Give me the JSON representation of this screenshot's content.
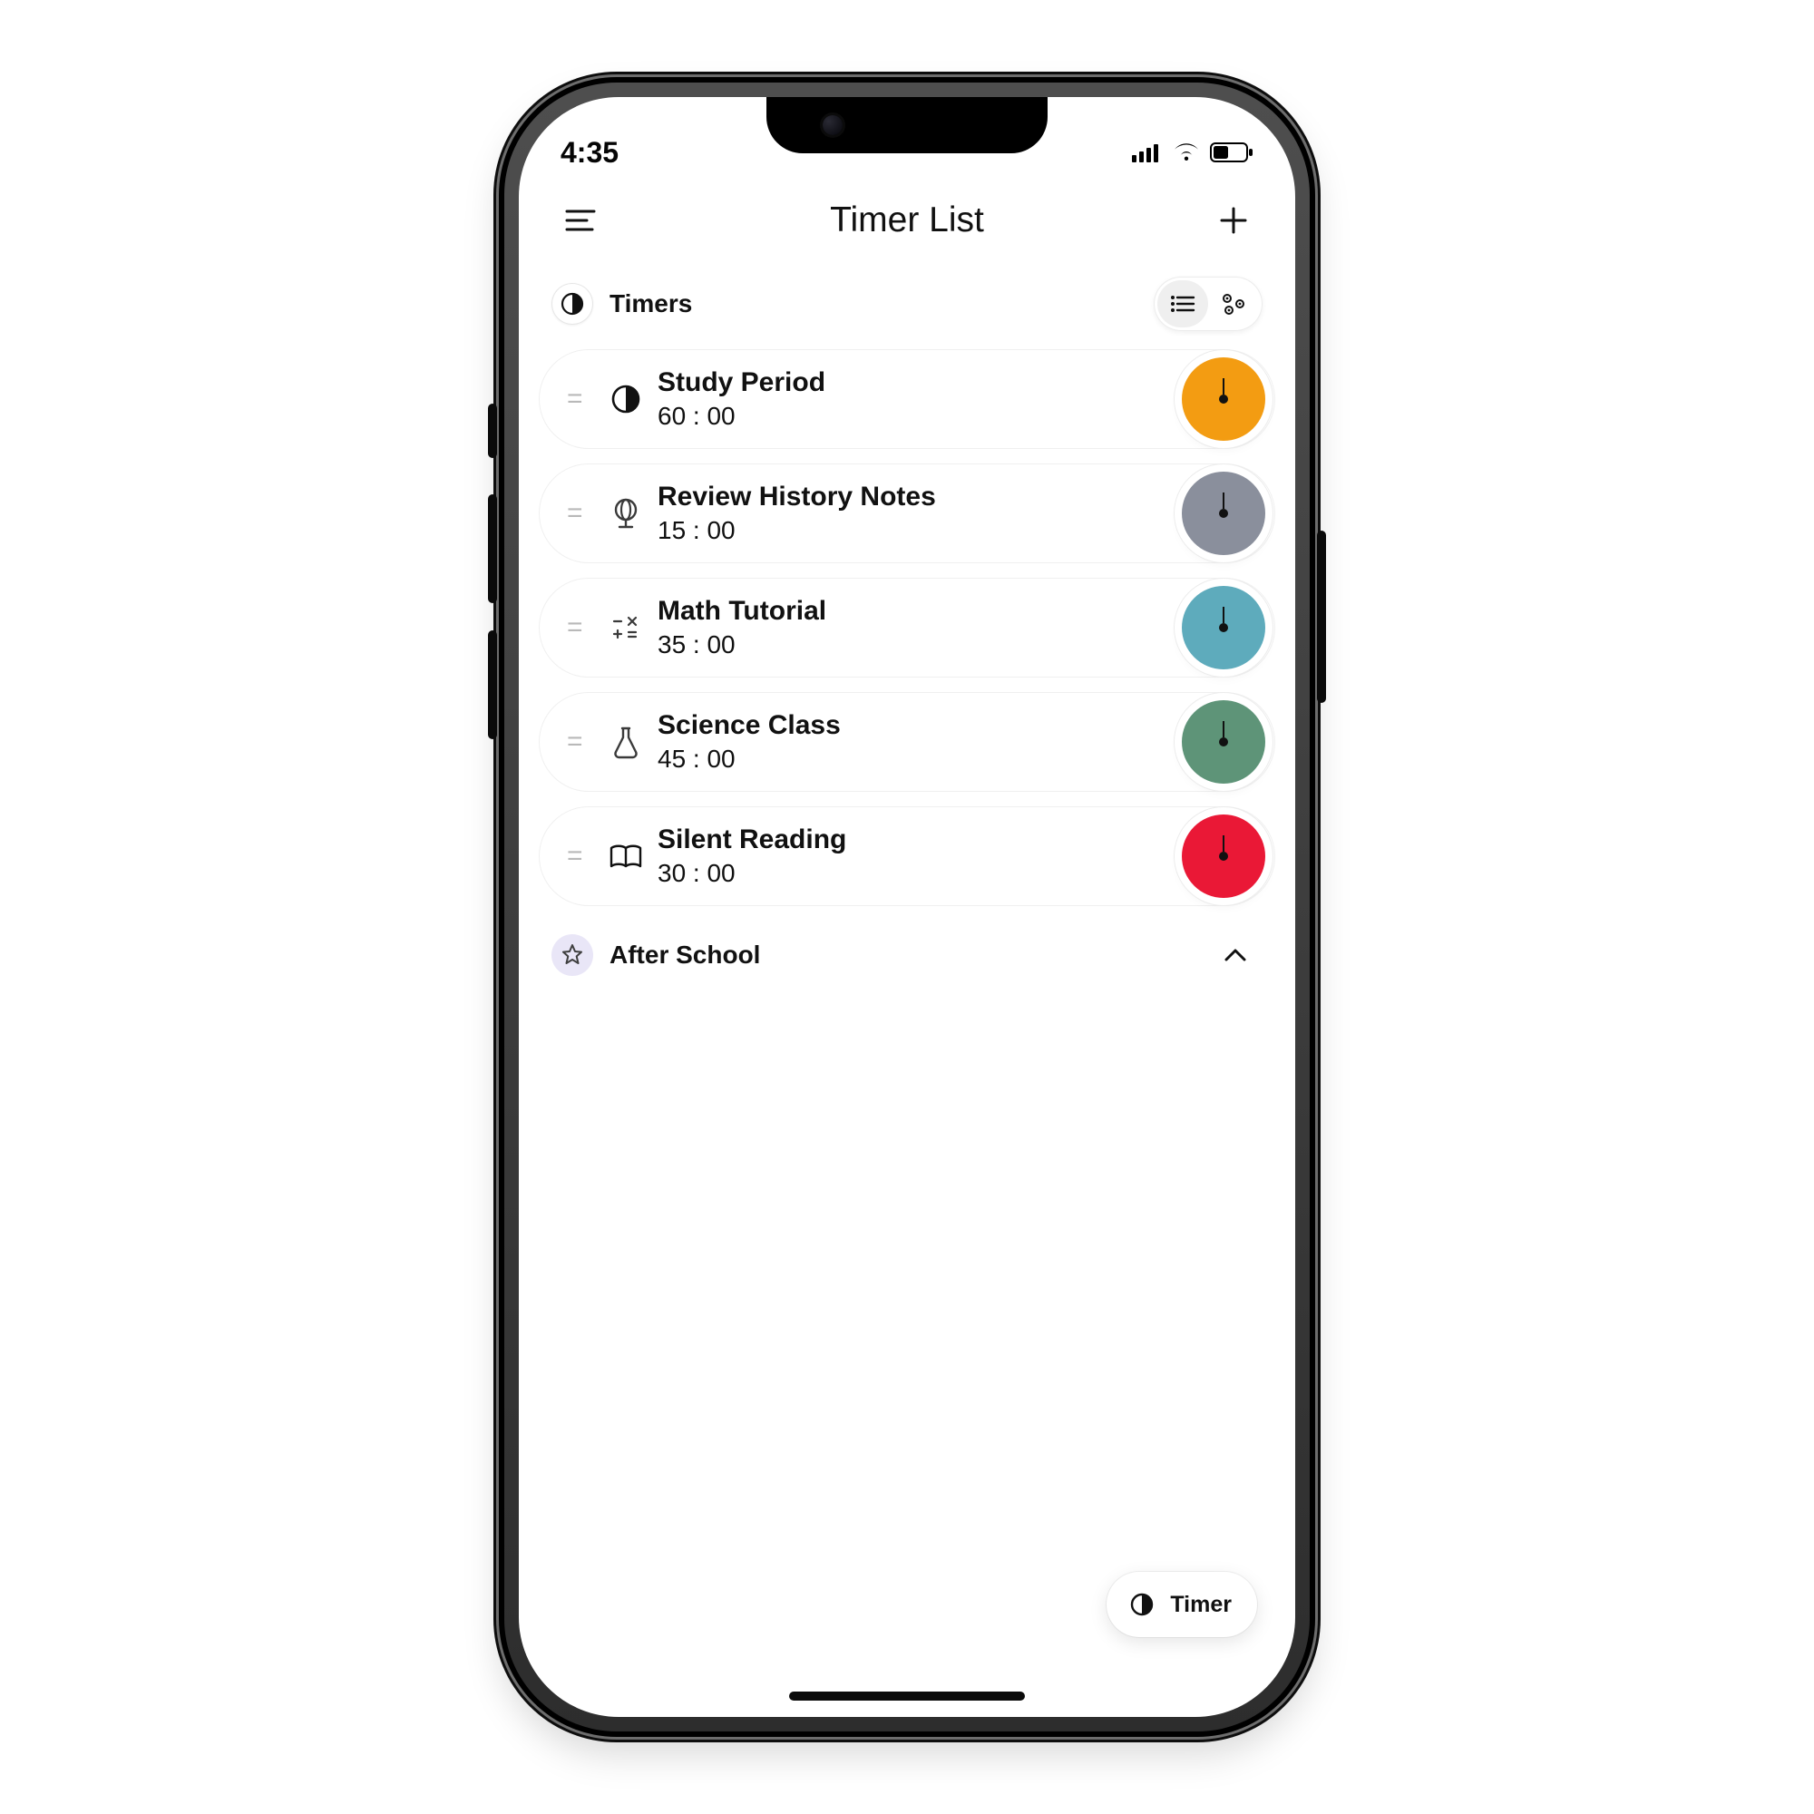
{
  "status": {
    "time": "4:35"
  },
  "header": {
    "title": "Timer List"
  },
  "section1": {
    "label": "Timers"
  },
  "timers": [
    {
      "name": "Study Period",
      "time": "60 : 00",
      "color": "#f39c12"
    },
    {
      "name": "Review History Notes",
      "time": "15 : 00",
      "color": "#8a8f9c"
    },
    {
      "name": "Math Tutorial",
      "time": "35 : 00",
      "color": "#5eabbc"
    },
    {
      "name": "Science Class",
      "time": "45 : 00",
      "color": "#5e9478"
    },
    {
      "name": "Silent Reading",
      "time": "30 : 00",
      "color": "#ea1836"
    }
  ],
  "section2": {
    "label": "After School"
  },
  "fab": {
    "label": "Timer"
  },
  "icons": {
    "menu": "menu-icon",
    "plus": "plus-icon",
    "moon": "moon-icon",
    "listview": "list-view-icon",
    "gridview": "grid-view-icon",
    "star": "star-icon",
    "chevron": "chevron-up-icon",
    "signal": "cellular-icon",
    "wifi": "wifi-icon",
    "battery": "battery-icon"
  }
}
